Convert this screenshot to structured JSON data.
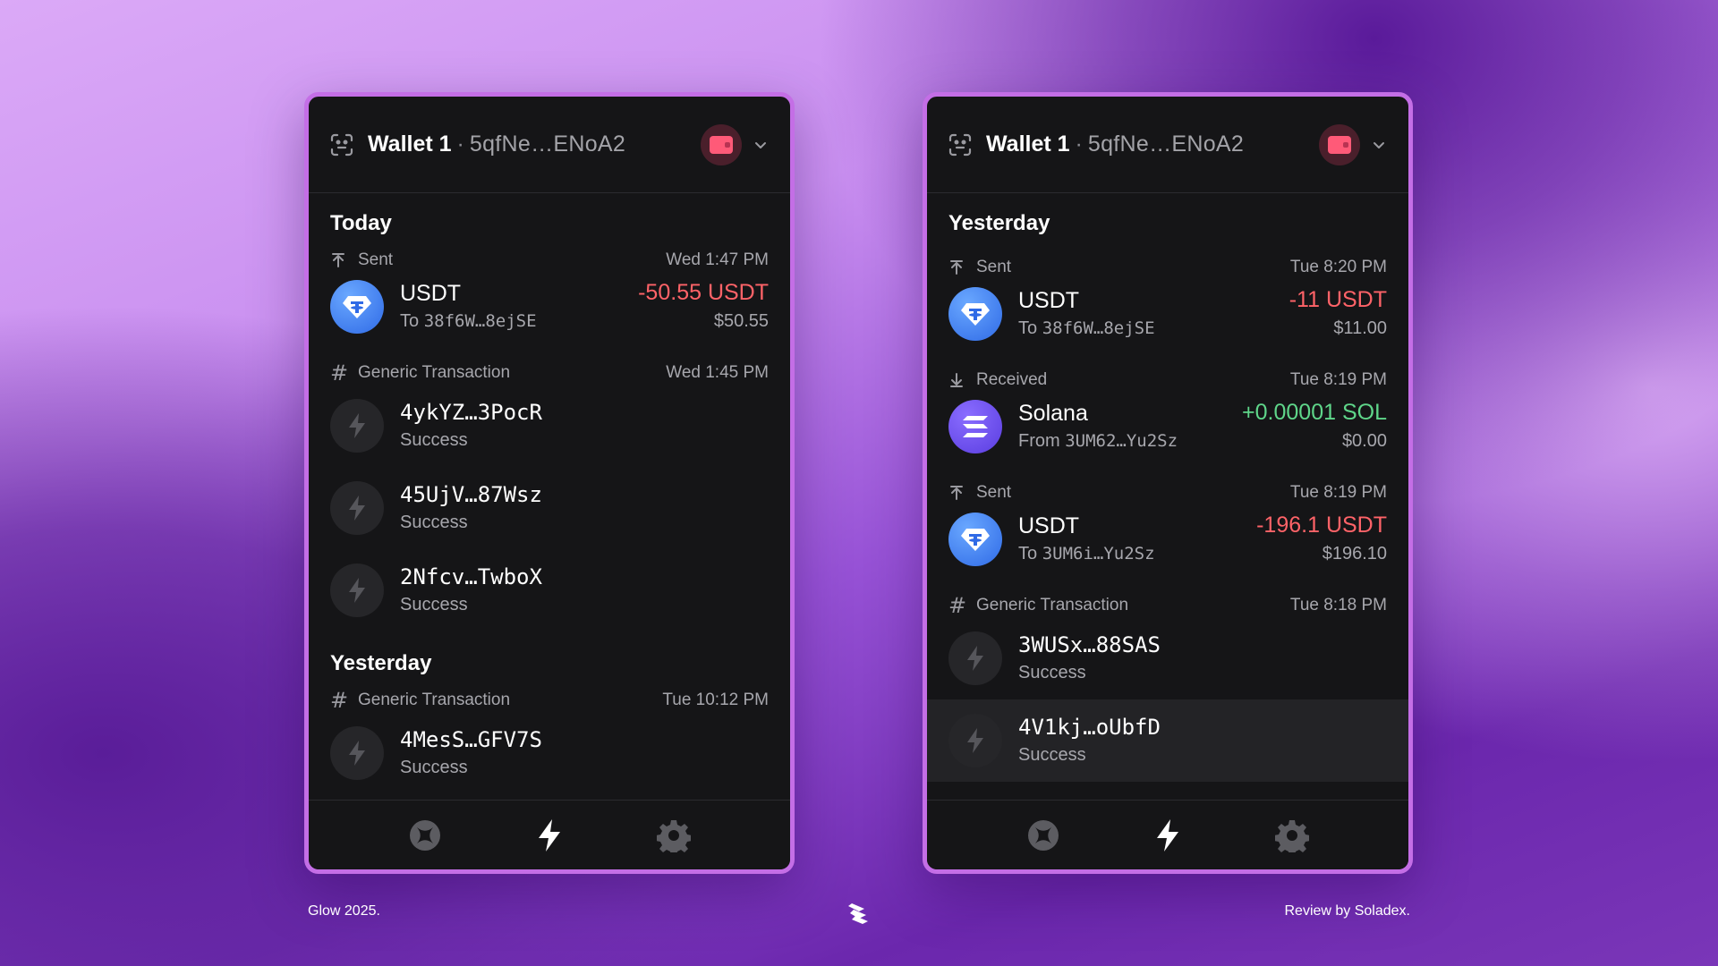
{
  "colors": {
    "panel_bg": "#151517",
    "panel_border": "#c46ee6",
    "negative": "#ff6368",
    "positive": "#5fd68a",
    "usdt": "#2f6ae6",
    "solana": "#5a3de0"
  },
  "left": {
    "header": {
      "wallet_name": "Wallet 1",
      "separator": "·",
      "address": "5qfNe…ENoA2"
    },
    "sections": [
      {
        "title": "Today",
        "txs": [
          {
            "kind": "sent",
            "type_label": "Sent",
            "time": "Wed 1:47 PM",
            "icon": "usdt-icon",
            "name": "USDT",
            "sub_prefix": "To ",
            "sub_addr": "38f6W…8ejSE",
            "amount": "-50.55 USDT",
            "fiat": "$50.55"
          },
          {
            "kind": "generic",
            "type_label": "Generic Transaction",
            "time": "Wed 1:45 PM",
            "icon": "bolt-icon",
            "name": "4ykYZ…3PocR",
            "status": "Success"
          },
          {
            "kind": "generic-cont",
            "icon": "bolt-icon",
            "name": "45UjV…87Wsz",
            "status": "Success"
          },
          {
            "kind": "generic-cont",
            "icon": "bolt-icon",
            "name": "2Nfcv…TwboX",
            "status": "Success"
          }
        ]
      },
      {
        "title": "Yesterday",
        "txs": [
          {
            "kind": "generic",
            "type_label": "Generic Transaction",
            "time": "Tue 10:12 PM",
            "icon": "bolt-icon",
            "name": "4MesS…GFV7S",
            "status": "Success"
          }
        ]
      }
    ]
  },
  "right": {
    "header": {
      "wallet_name": "Wallet 1",
      "separator": "·",
      "address": "5qfNe…ENoA2"
    },
    "sections": [
      {
        "title": "Yesterday",
        "txs": [
          {
            "kind": "sent",
            "type_label": "Sent",
            "time": "Tue 8:20 PM",
            "icon": "usdt-icon",
            "name": "USDT",
            "sub_prefix": "To ",
            "sub_addr": "38f6W…8ejSE",
            "amount": "-11 USDT",
            "fiat": "$11.00"
          },
          {
            "kind": "received",
            "type_label": "Received",
            "time": "Tue 8:19 PM",
            "icon": "solana-icon",
            "name": "Solana",
            "sub_prefix": "From ",
            "sub_addr": "3UM62…Yu2Sz",
            "amount": "+0.00001 SOL",
            "fiat": "$0.00"
          },
          {
            "kind": "sent",
            "type_label": "Sent",
            "time": "Tue 8:19 PM",
            "icon": "usdt-icon",
            "name": "USDT",
            "sub_prefix": "To ",
            "sub_addr": "3UM6i…Yu2Sz",
            "amount": "-196.1 USDT",
            "fiat": "$196.10"
          },
          {
            "kind": "generic",
            "type_label": "Generic Transaction",
            "time": "Tue 8:18 PM",
            "icon": "bolt-icon",
            "name": "3WUSx…88SAS",
            "status": "Success"
          },
          {
            "kind": "generic-cont",
            "icon": "bolt-icon",
            "name": "4V1kj…oUbfD",
            "status": "Success",
            "highlighted": true
          }
        ]
      }
    ]
  },
  "tabbar": {
    "tabs": [
      "explore-icon",
      "activity-bolt-icon",
      "settings-gear-icon"
    ],
    "active": "activity-bolt-icon"
  },
  "footer": {
    "left": "Glow 2025.",
    "right": "Review by Soladex.",
    "logo": "soladex-logo-icon"
  }
}
